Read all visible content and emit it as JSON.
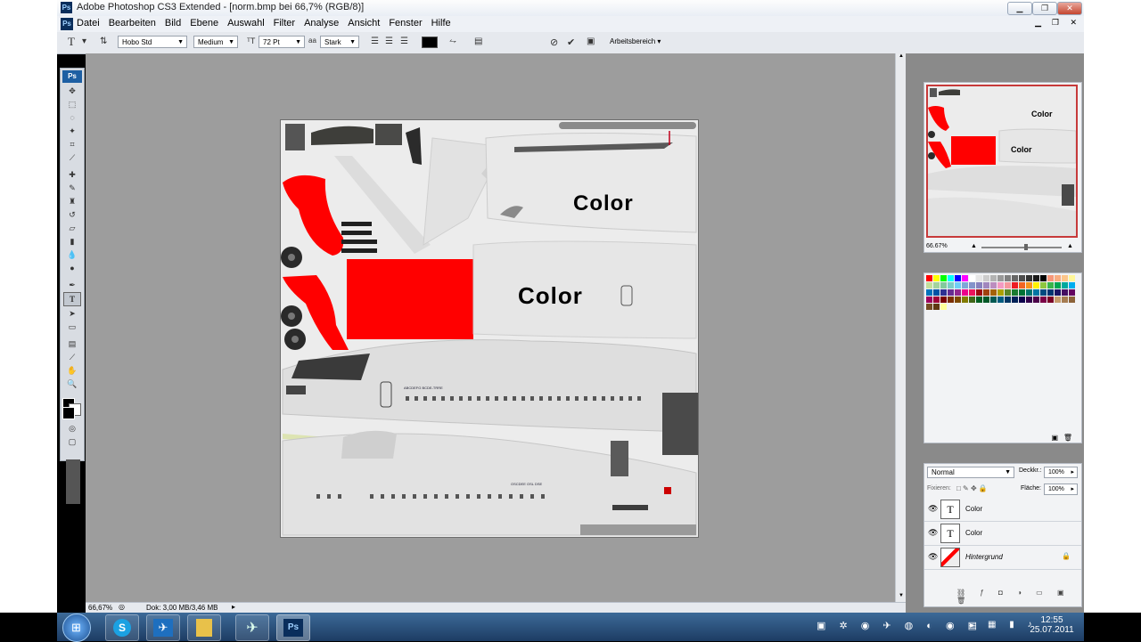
{
  "window": {
    "title": "Adobe Photoshop CS3 Extended - [norm.bmp bei 66,7% (RGB/8)]",
    "app_icon": "Ps",
    "controls": [
      "minimize-icon",
      "restore-icon",
      "close-icon"
    ]
  },
  "menubar": {
    "doc_icon": "Ps",
    "items": [
      "Datei",
      "Bearbeiten",
      "Bild",
      "Ebene",
      "Auswahl",
      "Filter",
      "Analyse",
      "Ansicht",
      "Fenster",
      "Hilfe"
    ]
  },
  "options": {
    "tool_glyph": "T",
    "font_family": "Hobo Std",
    "font_style": "Medium",
    "font_size": "72 Pt",
    "aa_prefix": "a",
    "aa_label": "aa",
    "antialias": "Stark",
    "workspace_label": "Arbeitsbereich"
  },
  "toolbox": {
    "logo": "Ps",
    "tools": [
      "move",
      "marquee",
      "lasso",
      "magic-wand",
      "crop",
      "slice",
      "heal",
      "brush",
      "stamp",
      "history-brush",
      "eraser",
      "gradient",
      "blur",
      "dodge",
      "pen",
      "type",
      "path-select",
      "shape",
      "notes",
      "eyedropper",
      "hand",
      "zoom"
    ]
  },
  "canvas": {
    "text_top": "Color",
    "text_mid": "Color",
    "label_small_1": "ABCDEFG BCDE-TRRE",
    "label_small_2": "OSCDEE OSL DSE"
  },
  "status": {
    "zoom": "66,67%",
    "doc": "Dok: 3,00 MB/3,46 MB"
  },
  "navigator": {
    "zoom": "66.67%",
    "text1": "Color",
    "text2": "Color"
  },
  "layers": {
    "blend_mode": "Normal",
    "opacity_label": "Deckkr.:",
    "opacity_value": "100%",
    "lock_label": "Fixieren:",
    "fill_label": "Fläche:",
    "fill_value": "100%",
    "items": [
      {
        "name": "Color",
        "type": "T"
      },
      {
        "name": "Color",
        "type": "T"
      },
      {
        "name": "Hintergrund",
        "type": "bg"
      }
    ]
  },
  "swatches": [
    "#ff0000",
    "#ffff00",
    "#00ff00",
    "#00ffff",
    "#0000ff",
    "#ff00ff",
    "#ffffff",
    "#e6e6e6",
    "#cccccc",
    "#b3b3b3",
    "#999999",
    "#808080",
    "#666666",
    "#4d4d4d",
    "#333333",
    "#1a1a1a",
    "#000000",
    "#f7977a",
    "#f9ad81",
    "#fdc68a",
    "#fff79a",
    "#c4df9b",
    "#a3d39c",
    "#82ca9d",
    "#7bcdc8",
    "#6ecff6",
    "#7ea7d8",
    "#8493ca",
    "#8882be",
    "#a187be",
    "#bc8dbf",
    "#f49ac2",
    "#f6989d",
    "#ed1c24",
    "#f26522",
    "#f7941d",
    "#fff200",
    "#8dc63f",
    "#39b54a",
    "#00a651",
    "#00a99d",
    "#00aeef",
    "#0072bc",
    "#0054a6",
    "#2e3192",
    "#662d91",
    "#92278f",
    "#ec008c",
    "#ed145b",
    "#9e0b0f",
    "#a0410d",
    "#a36209",
    "#aba000",
    "#598527",
    "#1a7b30",
    "#007236",
    "#00746b",
    "#0076a3",
    "#004b80",
    "#003471",
    "#1b1464",
    "#440e62",
    "#630460",
    "#9e005d",
    "#9e0039",
    "#790000",
    "#7b2e00",
    "#7d4900",
    "#827b00",
    "#406618",
    "#005e20",
    "#005826",
    "#005952",
    "#005b7f",
    "#003663",
    "#002157",
    "#0d004c",
    "#32004b",
    "#4b0049",
    "#7b0046",
    "#7a0026",
    "#c69c6d",
    "#a67c52",
    "#8c6239",
    "#754c24",
    "#603913",
    "#ffff99"
  ],
  "taskbar": {
    "time": "12:55",
    "date": "25.07.2011"
  }
}
